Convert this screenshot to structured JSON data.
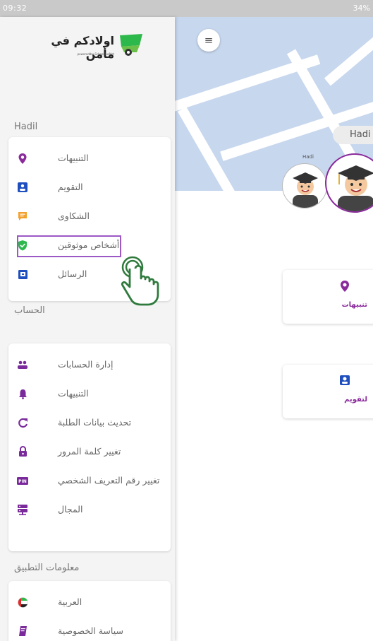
{
  "status_bar": {
    "time": "09:32",
    "battery": "34%"
  },
  "logo": {
    "title": "اولادكم في مأمن",
    "tagline": "powered by SchoolBusNet"
  },
  "drawer": {
    "child_section": {
      "title": "Hadil",
      "items": [
        {
          "label": "التنبيهات",
          "icon": "location-pin-icon",
          "color": "#8a2a9b"
        },
        {
          "label": "التقويم",
          "icon": "contact-card-icon",
          "color": "#1f4fbf"
        },
        {
          "label": "الشكاوى",
          "icon": "comment-icon",
          "color": "#f2a12c"
        },
        {
          "label": "أشخاص موثوقين",
          "icon": "verified-shield-icon",
          "color": "#2db84c"
        },
        {
          "label": "الرسائل",
          "icon": "message-box-icon",
          "color": "#1f4fbf"
        }
      ]
    },
    "account_section": {
      "title": "الحساب",
      "items": [
        {
          "label": "إدارة الحسابات",
          "icon": "people-icon",
          "color": "#7a2a9b"
        },
        {
          "label": "التنبيهات",
          "icon": "bell-icon",
          "color": "#7a2a9b"
        },
        {
          "label": "تحديث بيانات الطلبة",
          "icon": "refresh-icon",
          "color": "#7a2a9b"
        },
        {
          "label": "تغيير كلمة المرور",
          "icon": "lock-icon",
          "color": "#7a2a9b"
        },
        {
          "label": "تغيير رقم التعريف الشخصي",
          "icon": "pin-badge-icon",
          "color": "#7a2a9b"
        },
        {
          "label": "المجال",
          "icon": "server-icon",
          "color": "#7a2a9b"
        }
      ]
    },
    "app_section": {
      "title": "معلومات التطبيق",
      "items": [
        {
          "label": "العربية",
          "icon": "uae-flag-icon",
          "color": "#2db84c"
        },
        {
          "label": "سياسة الخصوصية",
          "icon": "book-icon",
          "color": "#7a2a9b"
        }
      ]
    }
  },
  "main": {
    "menu_icon": "hamburger-icon",
    "child_name_chip": "Hadi",
    "small_avatar_name": "Hadi",
    "cards": [
      {
        "label": "تنبيهات",
        "icon": "location-pin-icon"
      },
      {
        "label": "لتقويم",
        "icon": "contact-card-icon"
      }
    ]
  }
}
